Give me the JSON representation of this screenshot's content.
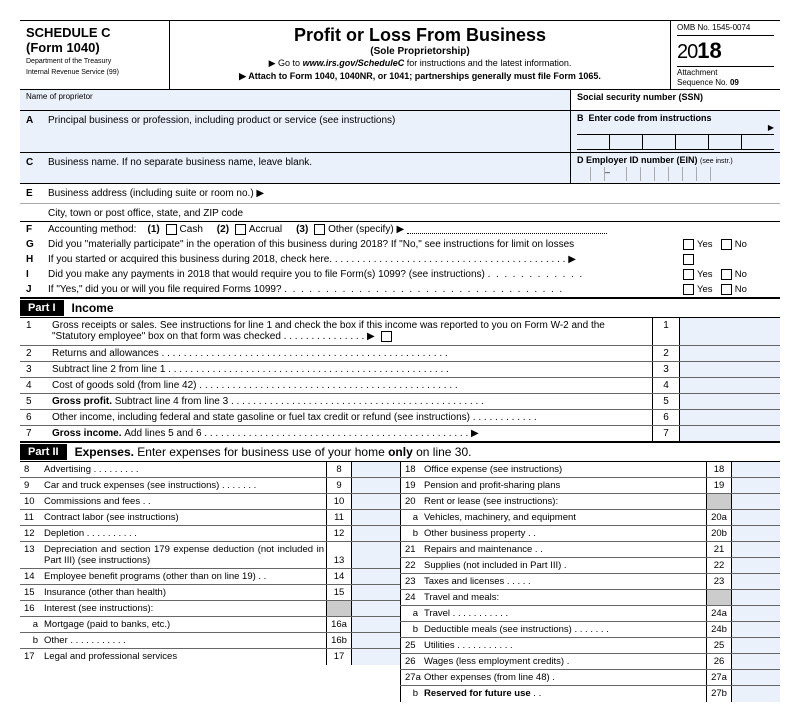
{
  "header": {
    "schedule": "SCHEDULE C",
    "form": "(Form 1040)",
    "dept1": "Department of the Treasury",
    "dept2": "Internal Revenue Service (99)",
    "title": "Profit or Loss From Business",
    "subtitle": "(Sole Proprietorship)",
    "instr1_pre": "▶ Go to ",
    "instr1_url": "www.irs.gov/ScheduleC",
    "instr1_post": " for instructions and the latest information.",
    "instr2": "▶ Attach to Form 1040, 1040NR, or 1041; partnerships generally must file Form 1065.",
    "omb": "OMB No. 1545-0074",
    "year_thin": "20",
    "year_bold": "18",
    "attach": "Attachment",
    "seqno": "Sequence No. ",
    "seqno_v": "09"
  },
  "top": {
    "name_prop": "Name of proprietor",
    "ssn": "Social security number (SSN)"
  },
  "A": {
    "label": "A",
    "desc": "Principal business or profession, including product or service (see instructions)"
  },
  "B": {
    "label": "B",
    "desc": "Enter code from instructions"
  },
  "C": {
    "label": "C",
    "desc": "Business name. If no separate business name, leave blank."
  },
  "D": {
    "label": "D",
    "desc": "Employer ID number (EIN) ",
    "note": "(see instr.)"
  },
  "E": {
    "label": "E",
    "desc1": "Business address (including suite or room no.) ▶",
    "desc2": "City, town or post office, state, and ZIP code"
  },
  "F": {
    "label": "F",
    "lead": "Accounting method:",
    "c1": "(1)",
    "c1l": "Cash",
    "c2": "(2)",
    "c2l": "Accrual",
    "c3": "(3)",
    "c3l": "Other (specify) ▶"
  },
  "G": {
    "label": "G",
    "desc": "Did you \"materially participate\" in the operation of this business during 2018? If \"No,\" see instructions for limit on losses"
  },
  "H": {
    "label": "H",
    "desc": "If you started or acquired this business during 2018, check here"
  },
  "I": {
    "label": "I",
    "desc": "Did you make any payments in 2018 that would require you to file Form(s) 1099? (see instructions)"
  },
  "J": {
    "label": "J",
    "desc": "If \"Yes,\" did you or will you file required Forms 1099?"
  },
  "yes": "Yes",
  "no": "No",
  "part1": {
    "lbl": "Part I",
    "title": "Income"
  },
  "inc": {
    "l1n": "1",
    "l1": "Gross receipts or sales. See instructions for line 1 and check the box if this income was reported to you on Form W-2 and the \"Statutory employee\" box on that form was checked",
    "l2n": "2",
    "l2": "Returns and allowances",
    "l3n": "3",
    "l3": "Subtract line 2 from line 1",
    "l4n": "4",
    "l4": "Cost of goods sold (from line 42)",
    "l5n": "5",
    "l5p": "Gross profit. ",
    "l5": "Subtract line 4 from line 3",
    "l6n": "6",
    "l6": "Other income, including federal and state gasoline or fuel tax credit or refund (see instructions)",
    "l7n": "7",
    "l7p": "Gross income. ",
    "l7": "Add lines 5 and 6"
  },
  "part2": {
    "lbl": "Part II",
    "title_pre": "Expenses. ",
    "title": "Enter expenses for business use of your home ",
    "title_bold": "only",
    "title_post": " on line 30."
  },
  "exp": {
    "l8n": "8",
    "l8": "Advertising",
    "l9n": "9",
    "l9": "Car and truck expenses (see instructions)",
    "l10n": "10",
    "l10": "Commissions and fees",
    "l11n": "11",
    "l11": "Contract labor (see instructions)",
    "l12n": "12",
    "l12": "Depletion",
    "l13n": "13",
    "l13": "Depreciation and section 179 expense deduction (not included in Part III) (see instructions)",
    "l14n": "14",
    "l14": "Employee benefit programs (other than on line 19)",
    "l15n": "15",
    "l15": "Insurance (other than health)",
    "l16n": "16",
    "l16": "Interest (see instructions):",
    "l16an": "a",
    "l16a": "Mortgage (paid to banks, etc.)",
    "l16ab": "16a",
    "l16bn": "b",
    "l16b": "Other",
    "l16bb": "16b",
    "l17n": "17",
    "l17": "Legal and professional services",
    "l18n": "18",
    "l18": "Office expense (see instructions)",
    "l19n": "19",
    "l19": "Pension and profit-sharing plans",
    "l20n": "20",
    "l20": "Rent or lease (see instructions):",
    "l20an": "a",
    "l20a": "Vehicles, machinery, and equipment",
    "l20ab": "20a",
    "l20bn": "b",
    "l20b": "Other business property",
    "l20bb": "20b",
    "l21n": "21",
    "l21": "Repairs and maintenance",
    "l22n": "22",
    "l22": "Supplies (not included in Part III)",
    "l23n": "23",
    "l23": "Taxes and licenses",
    "l24n": "24",
    "l24": "Travel and meals:",
    "l24an": "a",
    "l24a": "Travel",
    "l24ab": "24a",
    "l24bn": "b",
    "l24b": "Deductible meals (see instructions)",
    "l24bb": "24b",
    "l25n": "25",
    "l25": "Utilities",
    "l26n": "26",
    "l26": "Wages (less employment credits)",
    "l27an": "27a",
    "l27a": "Other expenses (from line 48)",
    "l27ab": "27a",
    "l27bn": "b",
    "l27b": "Reserved for future use",
    "l27bb": "27b"
  }
}
